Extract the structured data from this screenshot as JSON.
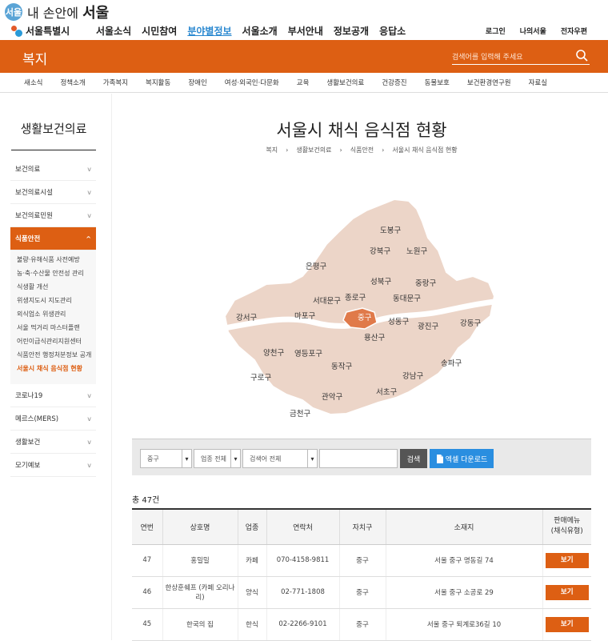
{
  "header": {
    "logo_slogan_small": "서울",
    "logo_slogan": "내 손안에",
    "logo_slogan_bold": "서울",
    "city_name": "서울특별시",
    "gnb": [
      "서울소식",
      "시민참여",
      "분야별정보",
      "서울소개",
      "부서안내",
      "정보공개",
      "응답소"
    ],
    "gnb_active_index": 2,
    "util_links": [
      "로그인",
      "나의서울",
      "전자우편"
    ]
  },
  "banner": {
    "title": "복지",
    "search_placeholder": "검색어를 입력해 주세요"
  },
  "subnav": [
    "새소식",
    "정책소개",
    "가족복지",
    "복지활동",
    "장애인",
    "여성·외국인·다문화",
    "교육",
    "생활보건의료",
    "건강증진",
    "동물보호",
    "보건환경연구원",
    "자료실"
  ],
  "sidebar": {
    "heading": "생활보건의료",
    "items": [
      {
        "label": "보건의료",
        "chevron": "v"
      },
      {
        "label": "보건의료시설",
        "chevron": "v"
      },
      {
        "label": "보건의료민원",
        "chevron": "v"
      },
      {
        "label": "식품안전",
        "chevron": "^"
      },
      {
        "label": "코로나19",
        "chevron": "v"
      },
      {
        "label": "메르스(MERS)",
        "chevron": "v"
      },
      {
        "label": "생활보건",
        "chevron": "v"
      },
      {
        "label": "모기예보",
        "chevron": "v"
      }
    ],
    "subitems": [
      "불량·유해식품 사전예방",
      "농·축·수산물 안전성 관리",
      "식생활 개선",
      "위생지도시 지도관리",
      "외식업소 위생관리",
      "서울 먹거리 마스터플랜",
      "어린이급식관리지원센터",
      "식품안전 행정처분정보 공개",
      "서울시 채식 음식점 현황"
    ]
  },
  "page": {
    "title": "서울시 채식 음식점 현황",
    "breadcrumb": [
      "복지",
      "생활보건의료",
      "식품안전",
      "서울시 채식 음식점 현황"
    ],
    "breadcrumb_sep": "›"
  },
  "map": {
    "districts": [
      "도봉구",
      "강북구",
      "노원구",
      "은평구",
      "성북구",
      "중랑구",
      "종로구",
      "동대문구",
      "서대문구",
      "마포구",
      "중구",
      "성동구",
      "광진구",
      "강동구",
      "강서구",
      "용산구",
      "양천구",
      "영등포구",
      "동작구",
      "송파구",
      "강남구",
      "구로구",
      "관악구",
      "서초구",
      "금천구"
    ],
    "selected": "중구",
    "fill_color": "#ecd5c8",
    "selected_color": "#e07a4a",
    "stroke_color": "#ffffff"
  },
  "filter": {
    "district_select": "중구",
    "type_select": "업종 전체",
    "keyword_type_select": "검색어 전체",
    "keyword_value": "",
    "search_button": "검색",
    "excel_button": "엑셀 다운로드",
    "excel_icon": "file-icon"
  },
  "results": {
    "count_text": "총 47건",
    "columns": [
      "연번",
      "상호명",
      "업종",
      "연락처",
      "자치구",
      "소재지",
      "판매메뉴\n(채식유형)"
    ],
    "rows": [
      {
        "no": "47",
        "name": "홍밀밀",
        "type": "카페",
        "phone": "070-4158-9811",
        "district": "중구",
        "address": "서울 중구 명동길 74",
        "action": "보기"
      },
      {
        "no": "46",
        "name": "한상훈쉐프 (카페 오리나리)",
        "type": "양식",
        "phone": "02-771-1808",
        "district": "중구",
        "address": "서울 중구 소공로 29",
        "action": "보기"
      },
      {
        "no": "45",
        "name": "한국의 집",
        "type": "한식",
        "phone": "02-2266-9101",
        "district": "중구",
        "address": "서울 중구 퇴계로36길 10",
        "action": "보기"
      }
    ]
  },
  "colors": {
    "accent": "#dd5f13",
    "link_active": "#2a88d0",
    "excel_button": "#2a8ee0"
  }
}
